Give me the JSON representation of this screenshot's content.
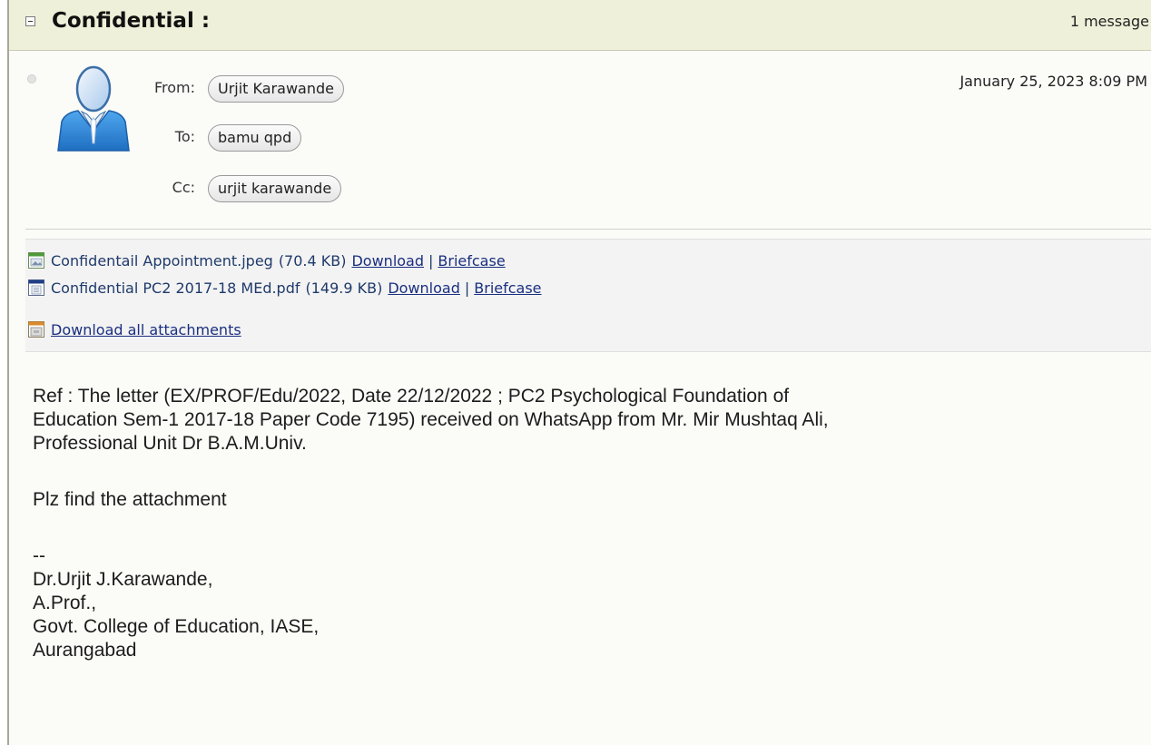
{
  "conversation": {
    "subject": "Confidential :",
    "message_count": "1 message"
  },
  "message": {
    "from_label": "From:",
    "from": "Urjit Karawande",
    "to_label": "To:",
    "to": "bamu qpd",
    "cc_label": "Cc:",
    "cc": "urjit karawande",
    "date": "January 25, 2023 8:09 PM"
  },
  "attachments": {
    "items": [
      {
        "name": "Confidentail Appointment.jpeg",
        "size": "(70.4 KB)",
        "download_label": "Download",
        "separator": "|",
        "briefcase_label": "Briefcase",
        "icon": "image-file-icon"
      },
      {
        "name": "Confidential PC2 2017-18 MEd.pdf",
        "size": "(149.9 KB)",
        "download_label": "Download",
        "separator": "|",
        "briefcase_label": "Briefcase",
        "icon": "document-file-icon"
      }
    ],
    "download_all_label": "Download all attachments",
    "download_all_icon": "archive-icon"
  },
  "body": {
    "lines": [
      "Ref : The letter (EX/PROF/Edu/2022, Date 22/12/2022 ; PC2 Psychological Foundation of",
      "Education Sem-1 2017-18 Paper Code 7195) received on WhatsApp from Mr. Mir Mushtaq Ali,",
      "Professional Unit Dr B.A.M.Univ.",
      "Plz find the attachment",
      "--",
      "Dr.Urjit J.Karawande,",
      "A.Prof.,",
      "Govt. College of Education, IASE,",
      "Aurangabad"
    ]
  },
  "colors": {
    "header_bg": "#eff0d9",
    "link": "#1a2f80",
    "avatar_blue": "#2f8fe0"
  }
}
